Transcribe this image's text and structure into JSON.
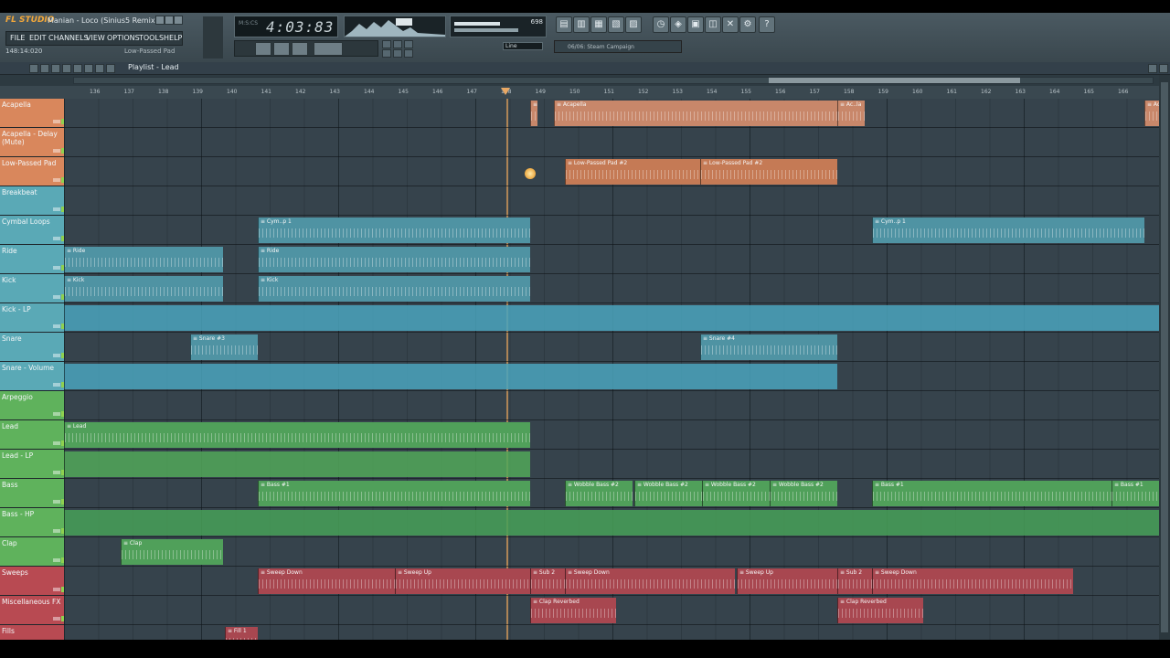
{
  "app": {
    "logo": "FL STUDIO",
    "song_title": "Manian - Loco (Sinius5 Remix)",
    "menu": [
      "FILE",
      "EDIT",
      "CHANNELS",
      "VIEW",
      "OPTIONS",
      "TOOLS",
      "HELP"
    ],
    "position": "148:14:020",
    "hint_channel": "Low-Passed Pad",
    "time_display": "4:03:83",
    "meter_value": "698",
    "line_mode": "Line",
    "hint_bar_text": "06/06: Steam Campaign",
    "playlist_title": "Playlist - Lead"
  },
  "ruler": {
    "bars": [
      "136",
      "137",
      "138",
      "139",
      "140",
      "141",
      "142",
      "143",
      "144",
      "145",
      "146",
      "147",
      "148",
      "149",
      "150",
      "151",
      "152",
      "153",
      "154",
      "155",
      "156",
      "157",
      "158",
      "159",
      "160",
      "161",
      "162",
      "163",
      "164",
      "165",
      "166"
    ]
  },
  "tracks": [
    {
      "name": "Acapella",
      "color": "#d9875c"
    },
    {
      "name": "Acapella - Delay (Mute)",
      "color": "#d9875c"
    },
    {
      "name": "Low-Passed Pad",
      "color": "#d9875c"
    },
    {
      "name": "Breakbeat",
      "color": "#5aa9b6"
    },
    {
      "name": "Cymbal Loops",
      "color": "#5aa9b6"
    },
    {
      "name": "Ride",
      "color": "#5aa9b6"
    },
    {
      "name": "Kick",
      "color": "#5aa9b6"
    },
    {
      "name": "Kick - LP",
      "color": "#5aa9b6"
    },
    {
      "name": "Snare",
      "color": "#5aa9b6"
    },
    {
      "name": "Snare - Volume",
      "color": "#5aa9b6"
    },
    {
      "name": "Arpeggio",
      "color": "#5fb25c"
    },
    {
      "name": "Lead",
      "color": "#5fb25c"
    },
    {
      "name": "Lead - LP",
      "color": "#5fb25c"
    },
    {
      "name": "Bass",
      "color": "#5fb25c"
    },
    {
      "name": "Bass - HP",
      "color": "#5fb25c"
    },
    {
      "name": "Clap",
      "color": "#5fb25c"
    },
    {
      "name": "Sweeps",
      "color": "#b84a52"
    },
    {
      "name": "Miscellaneous FX",
      "color": "#b84a52"
    },
    {
      "name": "Fills",
      "color": "#b84a52"
    }
  ],
  "clips": [
    {
      "label": "Aca",
      "track": 0,
      "color": "#c8876a"
    },
    {
      "label": "Acapella",
      "track": 0,
      "color": "#c8876a"
    },
    {
      "label": "Ac..la",
      "track": 0,
      "color": "#c8876a"
    },
    {
      "label": "Ac",
      "track": 0,
      "color": "#c8876a"
    },
    {
      "label": "Low-Passed Pad #2",
      "track": 2,
      "color": "#c57a55"
    },
    {
      "label": "Low-Passed Pad #2",
      "track": 2,
      "color": "#c57a55"
    },
    {
      "label": "Cym..p 1",
      "track": 4,
      "color": "#4f93a3"
    },
    {
      "label": "Cym..p 1",
      "track": 4,
      "color": "#4f93a3"
    },
    {
      "label": "Ride",
      "track": 5,
      "color": "#4f93a3"
    },
    {
      "label": "Ride",
      "track": 5,
      "color": "#4f93a3"
    },
    {
      "label": "Kick",
      "track": 6,
      "color": "#4f93a3"
    },
    {
      "label": "Kick",
      "track": 6,
      "color": "#4f93a3"
    },
    {
      "label": "Snare #3",
      "track": 8,
      "color": "#4f93a3"
    },
    {
      "label": "Snare #4",
      "track": 8,
      "color": "#4f93a3"
    },
    {
      "label": "Lead",
      "track": 11,
      "color": "#50a05a"
    },
    {
      "label": "Bass #1",
      "track": 13,
      "color": "#50a05a"
    },
    {
      "label": "Wobble Bass #2",
      "track": 13,
      "color": "#50a05a"
    },
    {
      "label": "Wobble Bass #2",
      "track": 13,
      "color": "#50a05a"
    },
    {
      "label": "Wobble Bass #2",
      "track": 13,
      "color": "#50a05a"
    },
    {
      "label": "Wobble Bass #2",
      "track": 13,
      "color": "#50a05a"
    },
    {
      "label": "Bass #1",
      "track": 13,
      "color": "#50a05a"
    },
    {
      "label": "Bass #1",
      "track": 13,
      "color": "#50a05a"
    },
    {
      "label": "Clap",
      "track": 15,
      "color": "#50a05a"
    },
    {
      "label": "Sweep Down",
      "track": 16,
      "color": "#a84750"
    },
    {
      "label": "Sweep Up",
      "track": 16,
      "color": "#a84750"
    },
    {
      "label": "Sub 2",
      "track": 16,
      "color": "#a84750"
    },
    {
      "label": "Sweep Down",
      "track": 16,
      "color": "#a84750"
    },
    {
      "label": "Sweep Up",
      "track": 16,
      "color": "#a84750"
    },
    {
      "label": "Sub 2",
      "track": 16,
      "color": "#a84750"
    },
    {
      "label": "Sweep Down",
      "track": 16,
      "color": "#a84750"
    },
    {
      "label": "Clap Reverbed",
      "track": 17,
      "color": "#a84750"
    },
    {
      "label": "Clap Reverbed",
      "track": 17,
      "color": "#a84750"
    },
    {
      "label": "Fill 1",
      "track": 18,
      "color": "#a84750"
    }
  ]
}
